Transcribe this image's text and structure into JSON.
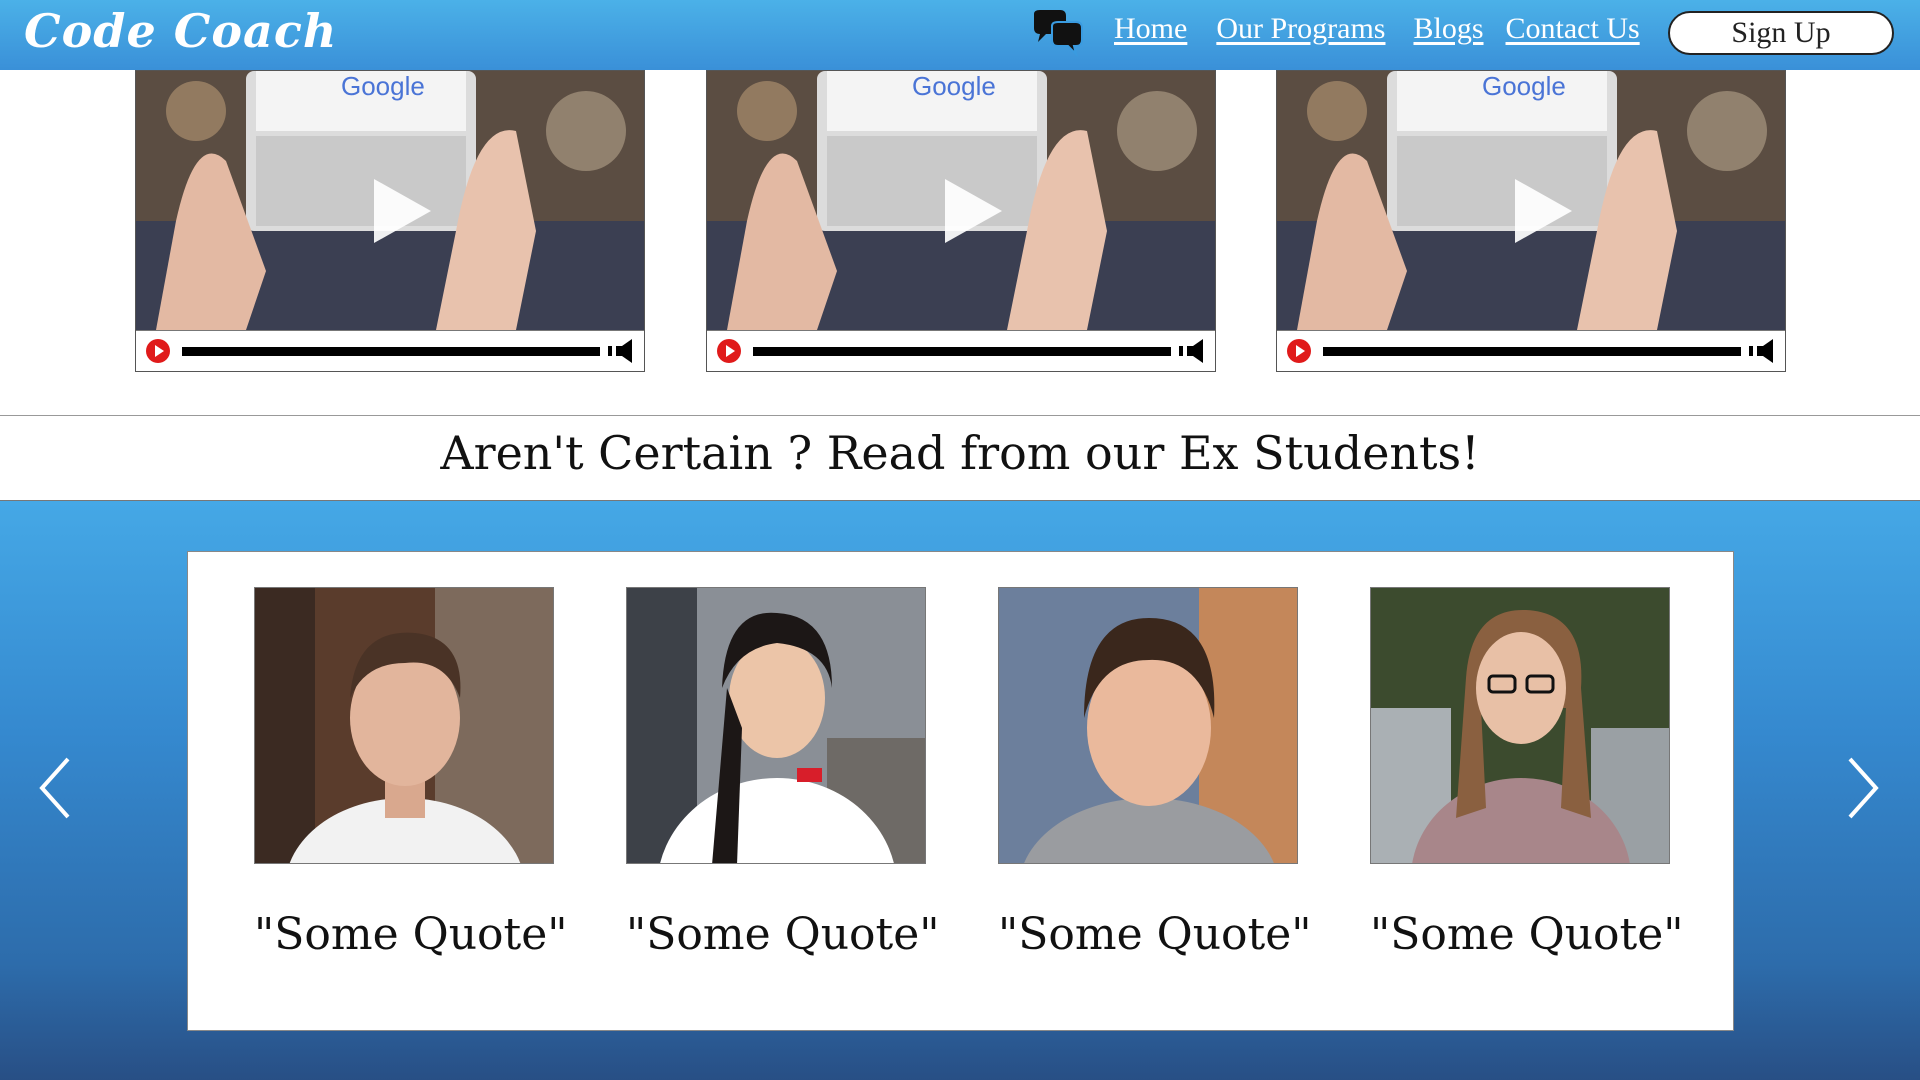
{
  "nav": {
    "brand": "Code Coach",
    "links": [
      "Home",
      "Our Programs",
      "Blogs",
      "Contact Us"
    ],
    "signup_label": "Sign Up",
    "chat_icon": "chat-bubbles-icon"
  },
  "videos": [
    {
      "thumbnail_text": "Google",
      "icon": "play-icon"
    },
    {
      "thumbnail_text": "Google",
      "icon": "play-icon"
    },
    {
      "thumbnail_text": "Google",
      "icon": "play-icon"
    }
  ],
  "testimonials": {
    "title": "Aren't Certain ? Read from our Ex Students!",
    "students": [
      {
        "quote": "\"Some Quote\""
      },
      {
        "quote": "\"Some Quote\""
      },
      {
        "quote": "\"Some Quote\""
      },
      {
        "quote": "\"Some Quote\""
      }
    ]
  },
  "colors": {
    "nav_bg": "#3a9be0",
    "play_red": "#e01a1a",
    "carousel_bg": "#3589cf"
  }
}
